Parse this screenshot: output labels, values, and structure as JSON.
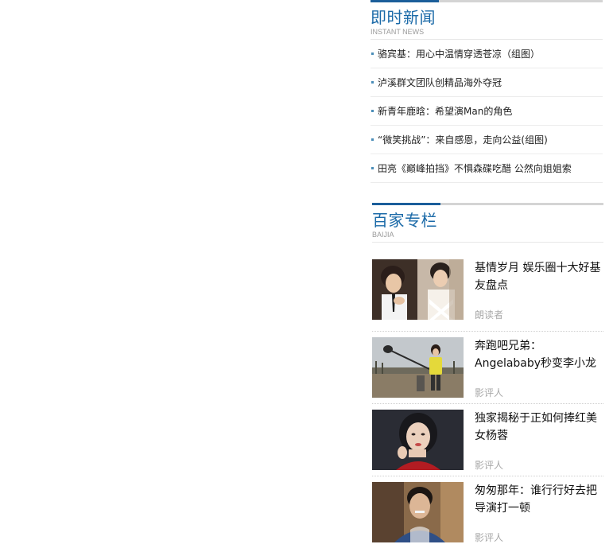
{
  "instant_news": {
    "title": "即时新闻",
    "subtitle": "INSTANT NEWS",
    "items": [
      {
        "text": "骆宾基：用心中温情穿透苍凉（组图）"
      },
      {
        "text": "泸溪群文团队创精品海外夺冠"
      },
      {
        "text": "新青年鹿晗：希望演Man的角色"
      },
      {
        "text": "“微笑挑战”：来自感恩，走向公益(组图)"
      },
      {
        "text": "田亮《巅峰拍挡》不惧森碟吃醋 公然向姐姐索"
      }
    ]
  },
  "baijia": {
    "title": "百家专栏",
    "subtitle": "BAIJIA",
    "cards": [
      {
        "title": "基情岁月 娱乐圈十大好基友盘点",
        "author": "朗读者",
        "thumb": "two-young-men-photo"
      },
      {
        "title": "奔跑吧兄弟：Angelababy秒变李小龙",
        "author": "影评人",
        "thumb": "woman-outdoor-photo"
      },
      {
        "title": "独家揭秘于正如何捧红美女杨蓉",
        "author": "影评人",
        "thumb": "actress-portrait-photo"
      },
      {
        "title": "匆匆那年：谁行行好去把导演打一顿",
        "author": "影评人",
        "thumb": "actor-portrait-photo"
      }
    ]
  },
  "colors": {
    "accent": "#1b6aa8",
    "bullet": "#4a8db8",
    "muted": "#a8a8a8"
  }
}
